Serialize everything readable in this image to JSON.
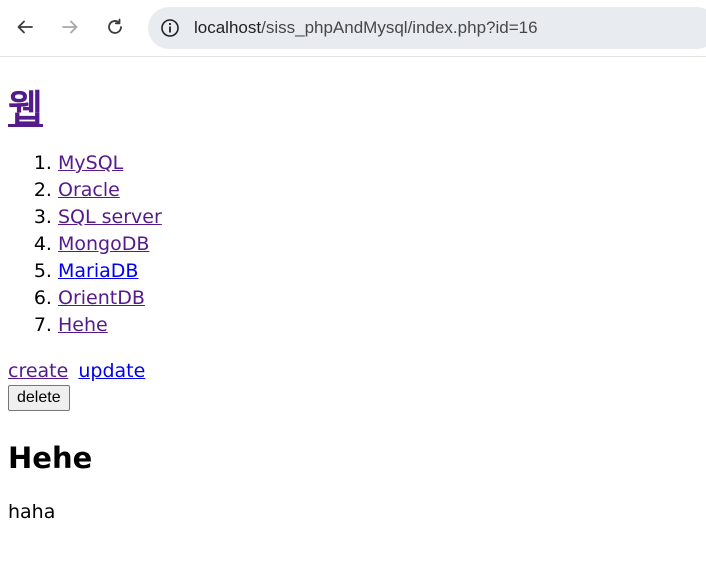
{
  "browser": {
    "url_host": "localhost",
    "url_path": "/siss_phpAndMysql/index.php?id=16"
  },
  "page": {
    "title": "웹",
    "topics": [
      {
        "label": "MySQL",
        "visited": true
      },
      {
        "label": "Oracle",
        "visited": true
      },
      {
        "label": "SQL server",
        "visited": true
      },
      {
        "label": "MongoDB",
        "visited": true
      },
      {
        "label": "MariaDB",
        "visited": false
      },
      {
        "label": "OrientDB",
        "visited": true
      },
      {
        "label": "Hehe",
        "visited": true
      }
    ],
    "actions": {
      "create": "create",
      "update": "update",
      "delete": "delete"
    },
    "article": {
      "heading": "Hehe",
      "body": "haha"
    }
  },
  "colors": {
    "visited_link": "#551a8b",
    "unvisited_link": "#0000ee",
    "omnibox_bg": "#e8ecf1"
  }
}
